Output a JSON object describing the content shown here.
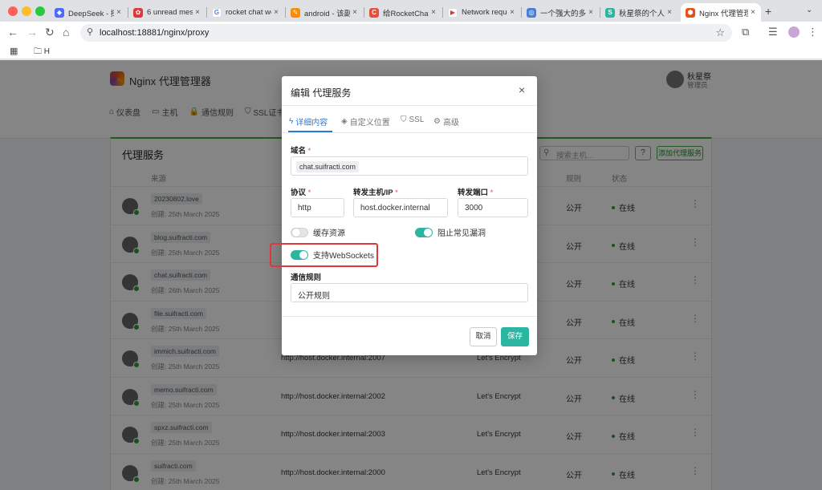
{
  "browser": {
    "tabs": [
      {
        "label": "DeepSeek - 探",
        "fav_color": "#4d6bfe",
        "fav_glyph": "◆"
      },
      {
        "label": "6 unread mess",
        "fav_color": "#e0373a",
        "fav_glyph": "✿"
      },
      {
        "label": "rocket chat we",
        "fav_color": "#ffffff",
        "fav_glyph": "G"
      },
      {
        "label": "android - 该副",
        "fav_color": "#ff8a00",
        "fav_glyph": "✎"
      },
      {
        "label": "给RocketChat",
        "fav_color": "#e94e3b",
        "fav_glyph": "C"
      },
      {
        "label": "Network reque",
        "fav_color": "#ffffff",
        "fav_glyph": "▶"
      },
      {
        "label": "一个强大的多功",
        "fav_color": "#4a7fd8",
        "fav_glyph": "◎"
      },
      {
        "label": "秋星祭的个人",
        "fav_color": "#2cb5a0",
        "fav_glyph": "S"
      },
      {
        "label": "Nginx 代理管理",
        "fav_color": "#e94e1b",
        "fav_glyph": "⬢"
      }
    ],
    "new_tab_icon": "+",
    "url": "localhost:18881/nginx/proxy",
    "bookmarks": {
      "folder": "H"
    }
  },
  "app": {
    "title": "Nginx 代理管理器",
    "user": {
      "name": "秋星祭",
      "role": "管理员"
    },
    "nav": [
      {
        "icon": "⌂",
        "label": "仪表盘"
      },
      {
        "icon": "▭",
        "label": "主机"
      },
      {
        "icon": "🔒",
        "label": "通信规则"
      },
      {
        "icon": "⛉",
        "label": "SSL证书"
      }
    ],
    "card": {
      "title": "代理服务",
      "search_placeholder": "搜索主机...",
      "help": "?",
      "add_button": "添加代理服务",
      "headers": {
        "source": "来源",
        "rule": "规则",
        "status": "状态"
      },
      "rows": [
        {
          "domain": "20230802.love",
          "created": "创建: 25th March 2025",
          "dest": "",
          "ssl": "",
          "access": "公开",
          "status": "在线"
        },
        {
          "domain": "blog.suifracti.com",
          "created": "创建: 25th March 2025",
          "dest": "",
          "ssl": "",
          "access": "公开",
          "status": "在线"
        },
        {
          "domain": "chat.suifracti.com",
          "created": "创建: 26th March 2025",
          "dest": "",
          "ssl": "",
          "access": "公开",
          "status": "在线"
        },
        {
          "domain": "file.suifracti.com",
          "created": "创建: 25th March 2025",
          "dest": "",
          "ssl": "",
          "access": "公开",
          "status": "在线"
        },
        {
          "domain": "immich.suifracti.com",
          "created": "创建: 25th March 2025",
          "dest": "http://host.docker.internal:2007",
          "ssl": "Let's Encrypt",
          "access": "公开",
          "status": "在线"
        },
        {
          "domain": "memo.suifracti.com",
          "created": "创建: 25th March 2025",
          "dest": "http://host.docker.internal:2002",
          "ssl": "Let's Encrypt",
          "access": "公开",
          "status": "在线"
        },
        {
          "domain": "spxz.suifracti.com",
          "created": "创建: 25th March 2025",
          "dest": "http://host.docker.internal:2003",
          "ssl": "Let's Encrypt",
          "access": "公开",
          "status": "在线"
        },
        {
          "domain": "suifracti.com",
          "created": "创建: 25th March 2025",
          "dest": "http://host.docker.internal:2000",
          "ssl": "Let's Encrypt",
          "access": "公开",
          "status": "在线"
        }
      ]
    }
  },
  "modal": {
    "title": "编辑 代理服务",
    "close": "×",
    "tabs": [
      {
        "icon": "ϟ",
        "label": "详细内容"
      },
      {
        "icon": "◈",
        "label": "自定义位置"
      },
      {
        "icon": "⛉",
        "label": "SSL"
      },
      {
        "icon": "⚙",
        "label": "高级"
      }
    ],
    "domain_label": "域名",
    "domain_value": "chat.suifracti.com",
    "scheme_label": "协议",
    "scheme_value": "http",
    "host_label": "转发主机/IP",
    "host_value": "host.docker.internal",
    "port_label": "转发端口",
    "port_value": "3000",
    "cache_label": "缓存资源",
    "cache_on": false,
    "block_label": "阻止常见漏洞",
    "block_on": true,
    "ws_label": "支持WebSockets",
    "ws_on": true,
    "access_label": "通信规则",
    "access_value": "公开规则",
    "cancel": "取消",
    "save": "保存",
    "required_mark": "*"
  }
}
